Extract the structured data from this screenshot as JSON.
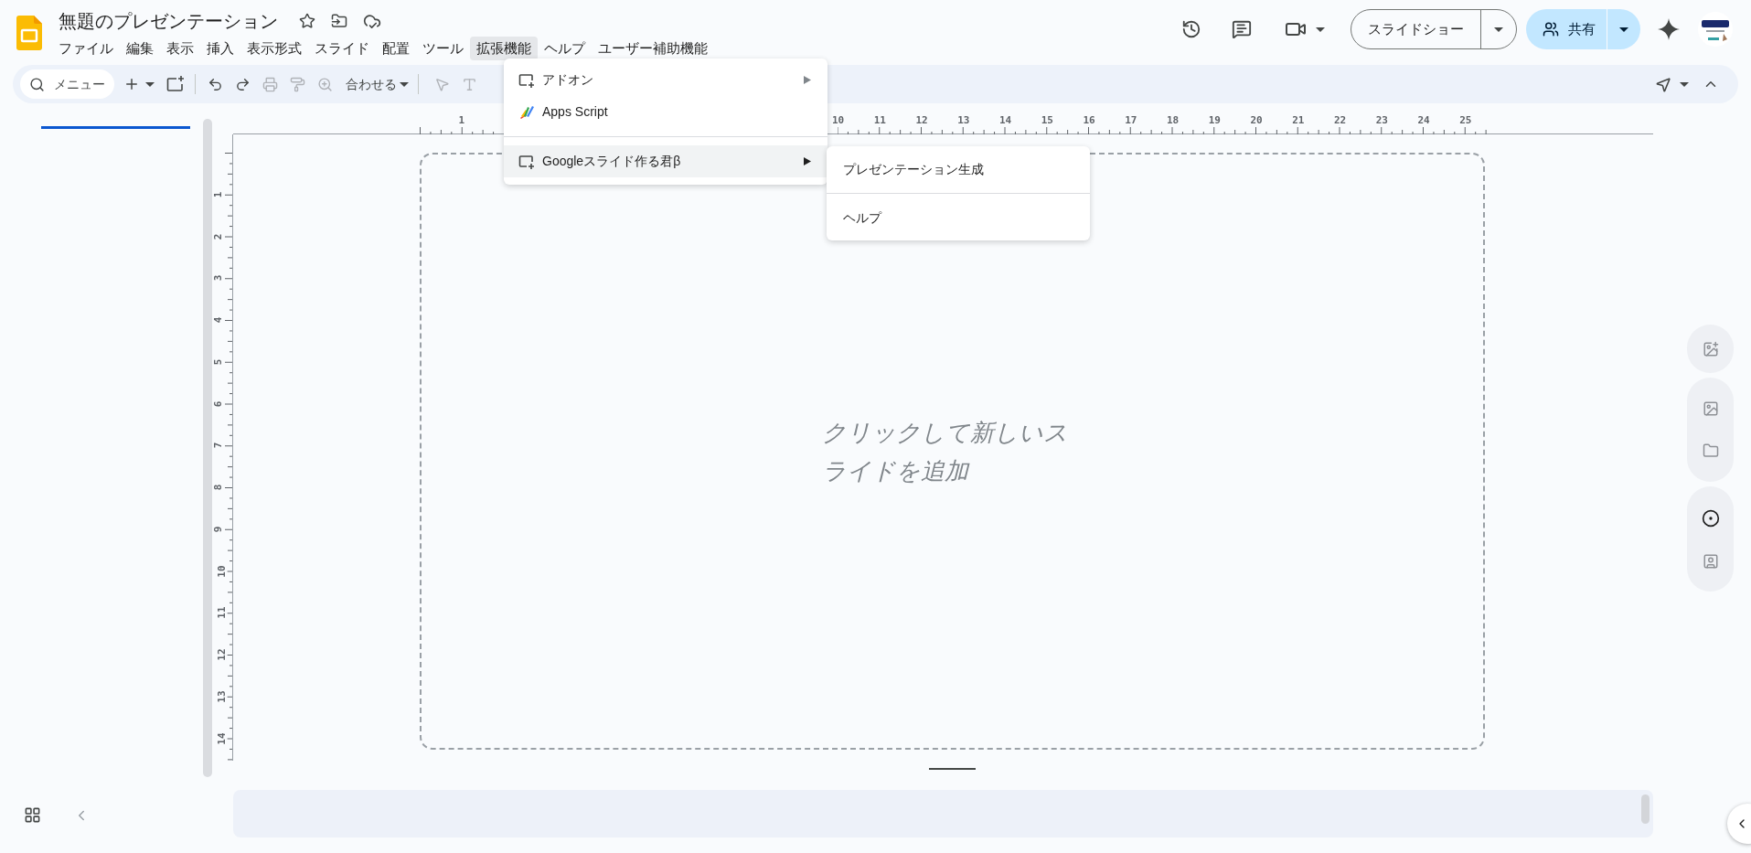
{
  "document": {
    "title": "無題のプレゼンテーション"
  },
  "menu_bar": [
    {
      "label": "ファイル",
      "selected": false
    },
    {
      "label": "編集",
      "selected": false
    },
    {
      "label": "表示",
      "selected": false
    },
    {
      "label": "挿入",
      "selected": false
    },
    {
      "label": "表示形式",
      "selected": false
    },
    {
      "label": "スライド",
      "selected": false
    },
    {
      "label": "配置",
      "selected": false
    },
    {
      "label": "ツール",
      "selected": false
    },
    {
      "label": "拡張機能",
      "selected": true
    },
    {
      "label": "ヘルプ",
      "selected": false
    },
    {
      "label": "ユーザー補助機能",
      "selected": false
    }
  ],
  "header_buttons": {
    "slideshow": "スライドショー",
    "share": "共有"
  },
  "toolbar": {
    "search_placeholder": "メニュー",
    "zoom": "合わせる"
  },
  "extensions_menu": [
    {
      "kind": "addon",
      "label": "アドオン",
      "has_submenu": true,
      "selected": false
    },
    {
      "kind": "script",
      "label": "Apps Script",
      "has_submenu": false,
      "selected": false
    },
    {
      "kind": "divider"
    },
    {
      "kind": "addon",
      "label": "Googleスライド作る君β",
      "has_submenu": true,
      "selected": true
    }
  ],
  "submenu": [
    {
      "kind": "item",
      "label": "プレゼンテーション生成"
    },
    {
      "kind": "divider"
    },
    {
      "kind": "item",
      "label": "ヘルプ"
    }
  ],
  "ruler": {
    "horizontal": [
      "1",
      "10",
      "11",
      "12",
      "13",
      "14",
      "15",
      "16",
      "17",
      "18",
      "19",
      "20",
      "21",
      "22",
      "23",
      "24",
      "25"
    ],
    "vertical": [
      "1",
      "2",
      "3",
      "4",
      "5",
      "6",
      "7",
      "8",
      "9",
      "10",
      "11",
      "12",
      "13",
      "14"
    ]
  },
  "slide": {
    "placeholder": "クリックして新しいスライドを追加"
  }
}
